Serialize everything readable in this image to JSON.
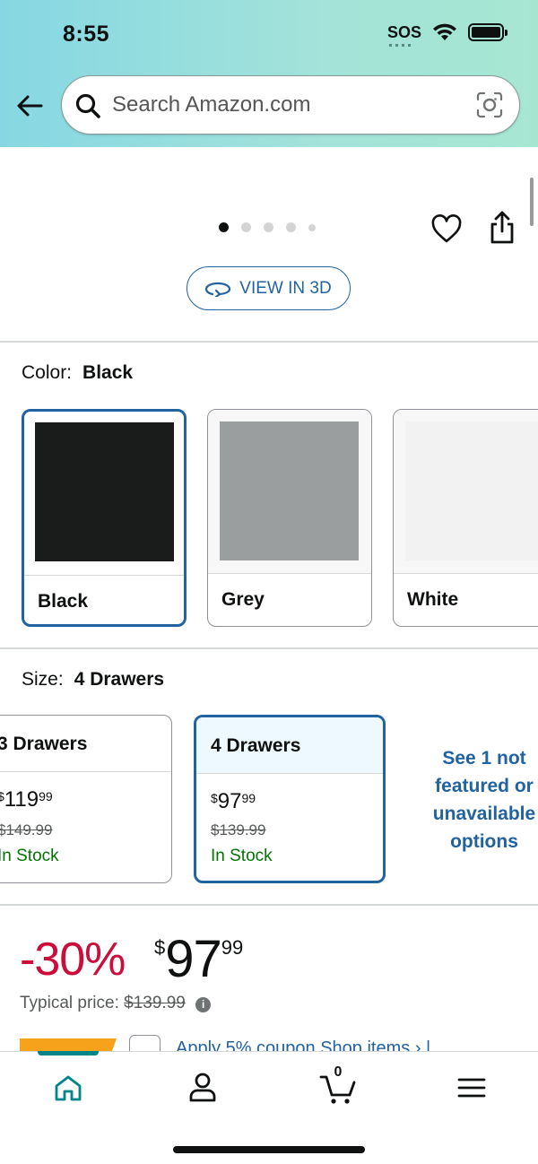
{
  "status_bar": {
    "time": "8:55",
    "sos": "SOS",
    "wifi_icon": "wifi-icon",
    "battery_icon": "battery-icon"
  },
  "header": {
    "back_icon": "arrow-left-icon",
    "search": {
      "placeholder": "Search Amazon.com",
      "camera_icon": "camera-lens-icon"
    }
  },
  "gallery": {
    "image_count": 5,
    "active_index": 0,
    "view_3d_label": "VIEW IN 3D"
  },
  "color": {
    "label": "Color:",
    "selected": "Black",
    "options": [
      {
        "name": "Black",
        "swatch": "#1a1b1b",
        "selected": true
      },
      {
        "name": "Grey",
        "swatch": "#9b9e9e",
        "selected": false
      },
      {
        "name": "White",
        "swatch": "#f2f2f2",
        "selected": false
      }
    ]
  },
  "size": {
    "label": "Size:",
    "selected": "4 Drawers",
    "options": [
      {
        "name": "3 Drawers",
        "price_currency": "$",
        "price_whole": "119",
        "price_fraction": "99",
        "list_price": "$149.99",
        "stock": "In Stock",
        "selected": false
      },
      {
        "name": "4 Drawers",
        "price_currency": "$",
        "price_whole": "97",
        "price_fraction": "99",
        "list_price": "$139.99",
        "stock": "In Stock",
        "selected": true
      }
    ],
    "see_more": "See 1 not featured or unavailable options"
  },
  "price": {
    "discount": "-30%",
    "currency": "$",
    "whole": "97",
    "fraction": "99",
    "typical_label": "Typical price:",
    "typical_price": "$139.99",
    "info_icon": "info-icon"
  },
  "coupon": {
    "text": "Apply 5% coupon  Shop items › |"
  },
  "bottom_nav": {
    "items": [
      {
        "name": "home",
        "icon": "home-icon",
        "active": true
      },
      {
        "name": "account",
        "icon": "person-icon",
        "active": false
      },
      {
        "name": "cart",
        "icon": "cart-icon",
        "active": false
      },
      {
        "name": "menu",
        "icon": "menu-icon",
        "active": false
      }
    ],
    "cart_count": "0"
  },
  "colors": {
    "accent": "#2162a1",
    "deal_red": "#cc0c39",
    "stock_green": "#007600",
    "teal": "#00858a"
  }
}
